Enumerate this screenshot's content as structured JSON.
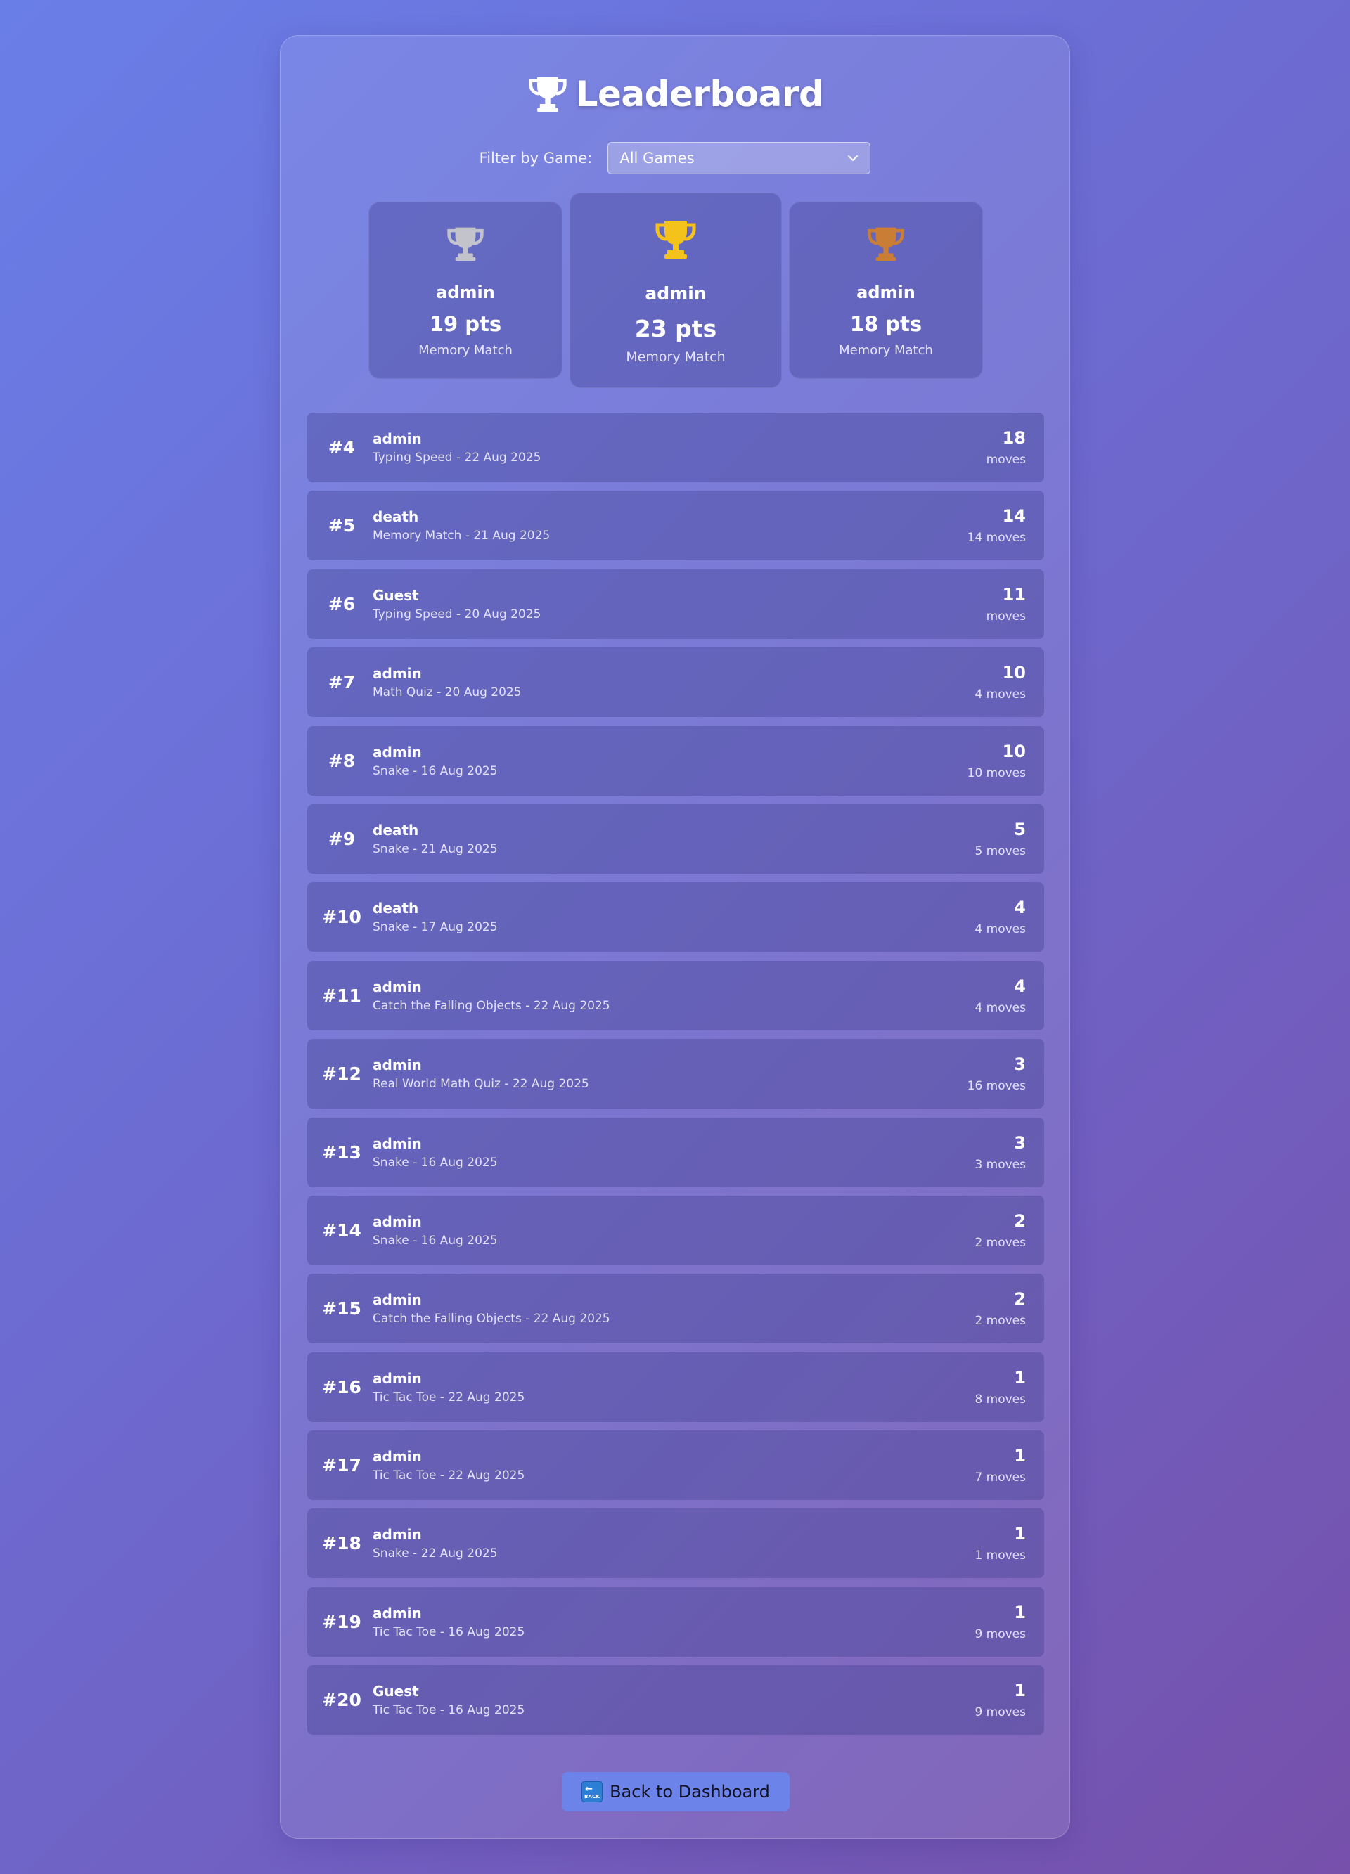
{
  "page": {
    "title": "Leaderboard",
    "title_icon": "trophy-icon"
  },
  "filter": {
    "label": "Filter by Game:",
    "selected": "All Games"
  },
  "podium": [
    {
      "place": 2,
      "name": "admin",
      "score": "19 pts",
      "game": "Memory Match",
      "color": "#c3c3cc",
      "icon": "silver-trophy-icon"
    },
    {
      "place": 1,
      "name": "admin",
      "score": "23 pts",
      "game": "Memory Match",
      "color": "#f3c21b",
      "icon": "gold-trophy-icon"
    },
    {
      "place": 3,
      "name": "admin",
      "score": "18 pts",
      "game": "Memory Match",
      "color": "#c97d35",
      "icon": "bronze-trophy-icon"
    }
  ],
  "rows": [
    {
      "rank": "#4",
      "player": "admin",
      "meta": "Typing Speed - 22 Aug 2025",
      "score": "18",
      "moves": "moves"
    },
    {
      "rank": "#5",
      "player": "death",
      "meta": "Memory Match - 21 Aug 2025",
      "score": "14",
      "moves": "14 moves"
    },
    {
      "rank": "#6",
      "player": "Guest",
      "meta": "Typing Speed - 20 Aug 2025",
      "score": "11",
      "moves": "moves"
    },
    {
      "rank": "#7",
      "player": "admin",
      "meta": "Math Quiz - 20 Aug 2025",
      "score": "10",
      "moves": "4 moves"
    },
    {
      "rank": "#8",
      "player": "admin",
      "meta": "Snake - 16 Aug 2025",
      "score": "10",
      "moves": "10 moves"
    },
    {
      "rank": "#9",
      "player": "death",
      "meta": "Snake - 21 Aug 2025",
      "score": "5",
      "moves": "5 moves"
    },
    {
      "rank": "#10",
      "player": "death",
      "meta": "Snake - 17 Aug 2025",
      "score": "4",
      "moves": "4 moves"
    },
    {
      "rank": "#11",
      "player": "admin",
      "meta": "Catch the Falling Objects - 22 Aug 2025",
      "score": "4",
      "moves": "4 moves"
    },
    {
      "rank": "#12",
      "player": "admin",
      "meta": "Real World Math Quiz - 22 Aug 2025",
      "score": "3",
      "moves": "16 moves"
    },
    {
      "rank": "#13",
      "player": "admin",
      "meta": "Snake - 16 Aug 2025",
      "score": "3",
      "moves": "3 moves"
    },
    {
      "rank": "#14",
      "player": "admin",
      "meta": "Snake - 16 Aug 2025",
      "score": "2",
      "moves": "2 moves"
    },
    {
      "rank": "#15",
      "player": "admin",
      "meta": "Catch the Falling Objects - 22 Aug 2025",
      "score": "2",
      "moves": "2 moves"
    },
    {
      "rank": "#16",
      "player": "admin",
      "meta": "Tic Tac Toe - 22 Aug 2025",
      "score": "1",
      "moves": "8 moves"
    },
    {
      "rank": "#17",
      "player": "admin",
      "meta": "Tic Tac Toe - 22 Aug 2025",
      "score": "1",
      "moves": "7 moves"
    },
    {
      "rank": "#18",
      "player": "admin",
      "meta": "Snake - 22 Aug 2025",
      "score": "1",
      "moves": "1 moves"
    },
    {
      "rank": "#19",
      "player": "admin",
      "meta": "Tic Tac Toe - 16 Aug 2025",
      "score": "1",
      "moves": "9 moves"
    },
    {
      "rank": "#20",
      "player": "Guest",
      "meta": "Tic Tac Toe - 16 Aug 2025",
      "score": "1",
      "moves": "9 moves"
    }
  ],
  "back_button": {
    "label": "Back to Dashboard",
    "icon": "back-arrow-icon",
    "icon_text": "BACK",
    "color": "#6c83e9"
  }
}
